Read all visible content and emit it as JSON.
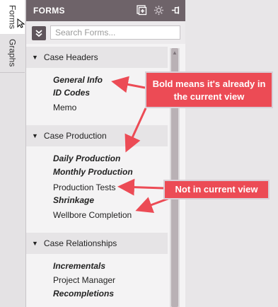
{
  "tabs": [
    {
      "label": "Forms"
    },
    {
      "label": "Graphs"
    }
  ],
  "panel": {
    "title": "FORMS",
    "search_placeholder": "Search Forms..."
  },
  "sections": [
    {
      "title": "Case Headers",
      "items": [
        "General Info",
        "ID Codes",
        "Memo"
      ]
    },
    {
      "title": "Case Production",
      "items": [
        "Daily Production",
        "Monthly Production",
        "Production Tests",
        "Shrinkage",
        "Wellbore Completion"
      ]
    },
    {
      "title": "Case Relationships",
      "items": [
        "Incrementals",
        "Project Manager",
        "Recompletions"
      ]
    }
  ],
  "callouts": {
    "bold": "Bold means it's already in the current view",
    "not_current": "Not in current view"
  },
  "colors": {
    "header": "#6e6369",
    "callout": "#ec4b55"
  }
}
